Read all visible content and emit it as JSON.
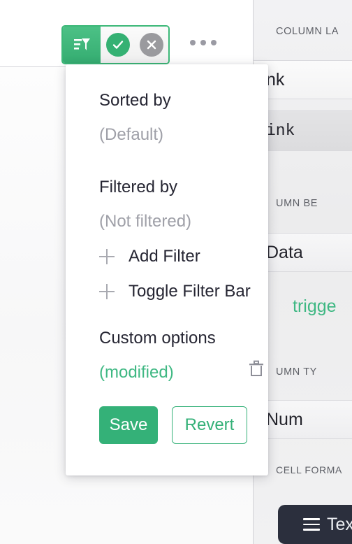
{
  "toolbar": {
    "filter_icon": "sort-filter-icon",
    "confirm_icon": "check-icon",
    "cancel_icon": "close-icon",
    "overflow_icon": "ellipsis-icon"
  },
  "popup": {
    "sorted_by_heading": "Sorted by",
    "sorted_by_value": "(Default)",
    "filtered_by_heading": "Filtered by",
    "filtered_by_value": "(Not filtered)",
    "add_filter_label": "Add Filter",
    "toggle_filter_bar_label": "Toggle Filter Bar",
    "custom_options_heading": "Custom options",
    "custom_options_value": "(modified)",
    "delete_icon": "trash-icon",
    "save_label": "Save",
    "revert_label": "Revert"
  },
  "side_panel": {
    "column_label_heading": "COLUMN LA",
    "column_label_value": "nk",
    "column_label_mono_value": "ink",
    "column_behavior_heading": "UMN BE",
    "column_behavior_value": "Data",
    "column_behavior_note": "trigge",
    "column_type_heading": "UMN TY",
    "column_type_value": "Num",
    "cell_format_heading": "CELL FORMA",
    "cell_format_value": "Tex",
    "cell_format_icon": "hamburger-icon"
  },
  "colors": {
    "accent_green": "#34b178",
    "muted_gray": "#9fa0a8",
    "dark_navy": "#2b2f3d"
  }
}
